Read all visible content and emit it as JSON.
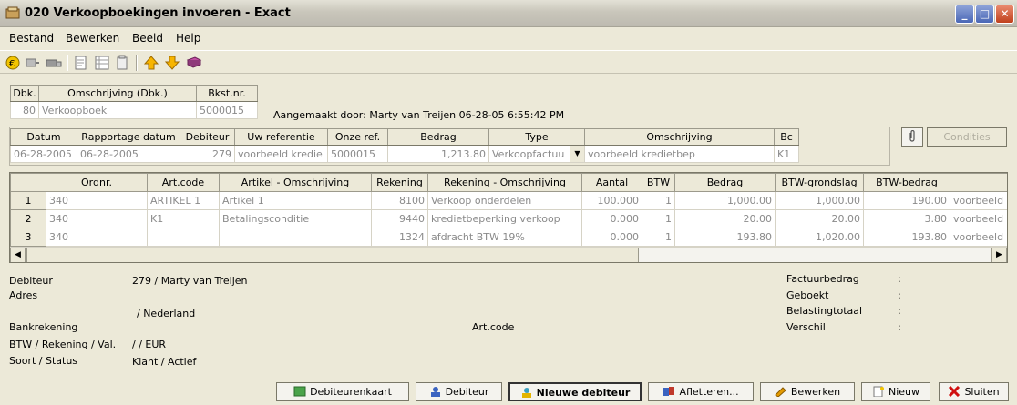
{
  "window": {
    "title": "020 Verkoopboekingen invoeren - Exact",
    "min": "_",
    "max": "□",
    "close": "✕"
  },
  "menu": [
    {
      "label": "Bestand"
    },
    {
      "label": "Bewerken"
    },
    {
      "label": "Beeld"
    },
    {
      "label": "Help"
    }
  ],
  "toolbar_icons": [
    "euro-icon",
    "arrows-icon",
    "truck-icon",
    "document-icon",
    "list-icon",
    "clipboard-icon",
    "arrow-up-icon",
    "arrow-down-icon",
    "book-icon"
  ],
  "journal": {
    "headers": [
      "Dbk.",
      "Omschrijving (Dbk.)",
      "Bkst.nr."
    ],
    "values": [
      "80",
      "Verkoopboek",
      "5000015"
    ]
  },
  "created_by": "Aangemaakt door: Marty van Treijen  06-28-05 6:55:42 PM",
  "entry": {
    "headers": [
      "Datum",
      "Rapportage datum",
      "Debiteur",
      "Uw referentie",
      "Onze ref.",
      "Bedrag",
      "Type",
      "Omschrijving",
      "Bc"
    ],
    "values": [
      "06-28-2005",
      "06-28-2005",
      "279",
      "voorbeeld kredie",
      "5000015",
      "1,213.80",
      "Verkoopfactuu",
      "voorbeeld kredietbep",
      "K1"
    ]
  },
  "condities_label": "Condities",
  "lines": {
    "headers": [
      "",
      "Ordnr.",
      "Art.code",
      "Artikel - Omschrijving",
      "Rekening",
      "Rekening - Omschrijving",
      "Aantal",
      "BTW",
      "Bedrag",
      "BTW-grondslag",
      "BTW-bedrag",
      ""
    ],
    "rows": [
      {
        "n": "1",
        "cells": [
          "340",
          "ARTIKEL 1",
          "Artikel 1",
          "8100",
          "Verkoop onderdelen",
          "100.000",
          "1",
          "1,000.00",
          "1,000.00",
          "190.00",
          "voorbeeld"
        ]
      },
      {
        "n": "2",
        "cells": [
          "340",
          "K1",
          "Betalingsconditie",
          "9440",
          "kredietbeperking verkoop",
          "0.000",
          "1",
          "20.00",
          "20.00",
          "3.80",
          "voorbeeld"
        ]
      },
      {
        "n": "3",
        "cells": [
          "340",
          "",
          "",
          "1324",
          "afdracht BTW 19%",
          "0.000",
          "1",
          "193.80",
          "1,020.00",
          "193.80",
          "voorbeeld"
        ]
      }
    ]
  },
  "info": {
    "debiteur_label": "Debiteur",
    "debiteur_value": "279 / Marty van Treijen",
    "adres_label": "Adres",
    "land_value": "/ Nederland",
    "bank_label": "Bankrekening",
    "artcode_label": "Art.code",
    "btw_label": "BTW / Rekening / Val.",
    "btw_value": "/  / EUR",
    "soort_label": "Soort / Status",
    "soort_value": "Klant / Actief",
    "factuur_label": "Factuurbedrag",
    "geboekt_label": "Geboekt",
    "belasting_label": "Belastingtotaal",
    "verschil_label": "Verschil",
    "colon": ":"
  },
  "buttons": {
    "debiteurenkaart": "Debiteurenkaart",
    "debiteur": "Debiteur",
    "nieuwe_debiteur": "Nieuwe debiteur",
    "afletteren": "Afletteren...",
    "bewerken": "Bewerken",
    "nieuw": "Nieuw",
    "sluiten": "Sluiten"
  }
}
